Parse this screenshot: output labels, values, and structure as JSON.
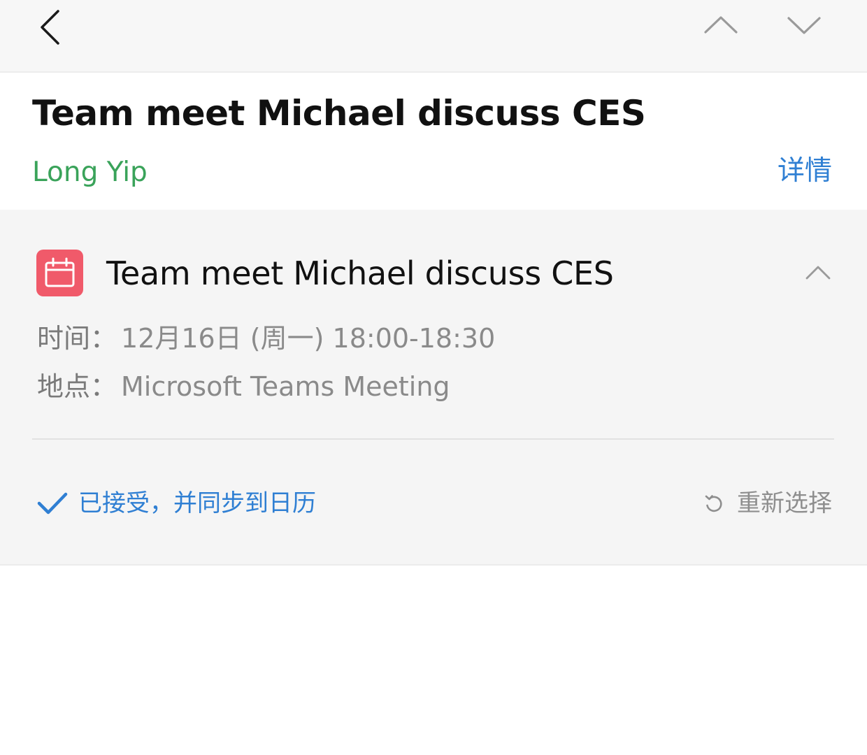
{
  "nav": {
    "back_icon": "chevron-left-icon",
    "prev_icon": "chevron-up-icon",
    "next_icon": "chevron-down-icon"
  },
  "header": {
    "subject": "Team meet Michael discuss CES",
    "sender": "Long Yip",
    "details_label": "详情"
  },
  "invite": {
    "icon": "calendar-icon",
    "title": "Team meet Michael discuss CES",
    "time_label": "时间：",
    "time_value": "12月16日 (周一) 18:00-18:30",
    "location_label": "地点：",
    "location_value": "Microsoft Teams Meeting",
    "status_text": "已接受，并同步到日历",
    "reselect_label": "重新选择"
  },
  "colors": {
    "accent_blue": "#2f7fd3",
    "sender_green": "#3aa35a",
    "calendar_red": "#f05a6a",
    "card_bg": "#f5f5f5"
  }
}
